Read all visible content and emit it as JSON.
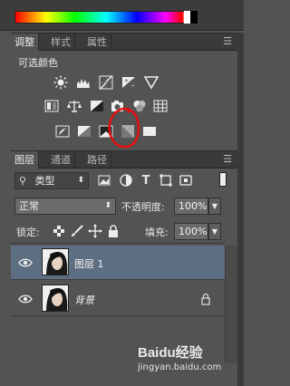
{
  "adjust_tabs": [
    "调整",
    "样式",
    "属性"
  ],
  "adjust_title": "可选颜色",
  "adjust_icons": {
    "row1": [
      "brightness-contrast-icon",
      "levels-icon",
      "curves-icon",
      "exposure-icon",
      "vibrance-icon"
    ],
    "row2": [
      "hue-saturation-icon",
      "color-balance-icon",
      "black-white-icon",
      "photo-filter-icon",
      "channel-mixer-icon",
      "color-lookup-icon"
    ],
    "row3": [
      "invert-icon",
      "posterize-icon",
      "threshold-icon",
      "selective-color-icon",
      "gradient-map-icon"
    ]
  },
  "layers_tabs": [
    "图层",
    "通道",
    "路径"
  ],
  "filter": {
    "kind_label": "类型"
  },
  "blend": {
    "mode": "正常",
    "opacity_label": "不透明度:",
    "opacity_value": "100%"
  },
  "lock": {
    "label": "锁定:",
    "fill_label": "填充:",
    "fill_value": "100%"
  },
  "layers": [
    {
      "name": "图层 1",
      "selected": true,
      "locked": false
    },
    {
      "name": "背景",
      "selected": false,
      "locked": true
    }
  ],
  "watermark": {
    "site": "Baidu经验",
    "url": "jingyan.baidu.com"
  },
  "colors": {
    "panel": "#535353",
    "selected_row": "#5e6e82",
    "highlight_circle": "#e01010"
  }
}
